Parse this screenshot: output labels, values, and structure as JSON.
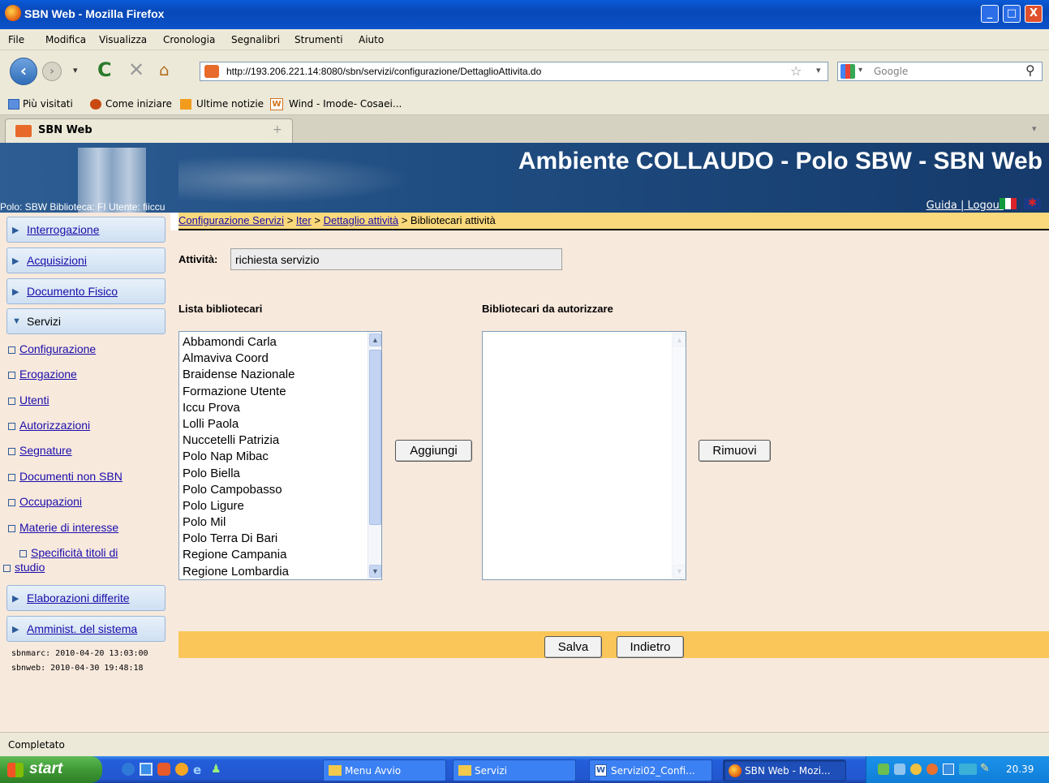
{
  "window": {
    "title": "SBN Web - Mozilla Firefox",
    "minimize": "_",
    "maximize": "□",
    "close": "X"
  },
  "menu": [
    "File",
    "Modifica",
    "Visualizza",
    "Cronologia",
    "Segnalibri",
    "Strumenti",
    "Aiuto"
  ],
  "nav": {
    "url": "http://193.206.221.14:8080/sbn/servizi/configurazione/DettaglioAttivita.do",
    "search_placeholder": "Google"
  },
  "bookmarks": [
    "Più visitati",
    "Come iniziare",
    "Ultime notizie",
    "Wind - Imode- Cosaei..."
  ],
  "tab": {
    "title": "SBN Web",
    "new_tab": "+"
  },
  "banner": {
    "title": "Ambiente COLLAUDO - Polo SBW - SBN Web",
    "polo_info": "Polo: SBW  Biblioteca: FI  Utente: fiiccu",
    "guida": "Guida",
    "sep": "|",
    "logout": "Logout"
  },
  "breadcrumb": {
    "item1": "Configurazione Servizi",
    "item2": "Iter",
    "item3": "Dettaglio attività",
    "current": "Bibliotecari attività",
    "sep": ">"
  },
  "sidebar": {
    "interrogazione": "Interrogazione",
    "acquisizioni": "Acquisizioni",
    "documento_fisico": "Documento Fisico",
    "servizi": "Servizi",
    "sub": [
      "Configurazione",
      "Erogazione",
      "Utenti",
      "Autorizzazioni",
      "Segnature",
      "Documenti non SBN",
      "Occupazioni",
      "Materie di interesse"
    ],
    "specificita_1": "Specificità titoli di",
    "specificita_2": "studio",
    "elaborazioni": "Elaborazioni differite",
    "amminist": "Amminist. del sistema",
    "ts1": "sbnmarc: 2010-04-20 13:03:00",
    "ts2": "sbnweb:  2010-04-30 19:48:18"
  },
  "form": {
    "attivita_label": "Attività:",
    "attivita_value": "richiesta servizio",
    "lista_label": "Lista bibliotecari",
    "autorizzare_label": "Bibliotecari da autorizzare",
    "lista": [
      "Abbamondi Carla",
      "Almaviva Coord",
      "Braidense Nazionale",
      "Formazione Utente",
      "Iccu Prova",
      "Lolli Paola",
      "Nuccetelli Patrizia",
      "Polo Nap Mibac",
      "Polo Biella",
      "Polo Campobasso",
      "Polo Ligure",
      "Polo Mil",
      "Polo Terra Di Bari",
      "Regione Campania",
      "Regione Lombardia"
    ],
    "aggiungi": "Aggiungi",
    "rimuovi": "Rimuovi",
    "salva": "Salva",
    "indietro": "Indietro"
  },
  "status": "Completato",
  "taskbar": {
    "start": "start",
    "tasks": [
      "Menu Avvio",
      "Servizi",
      "Servizi02_Confi...",
      "SBN Web - Mozi..."
    ],
    "clock": "20.39"
  }
}
